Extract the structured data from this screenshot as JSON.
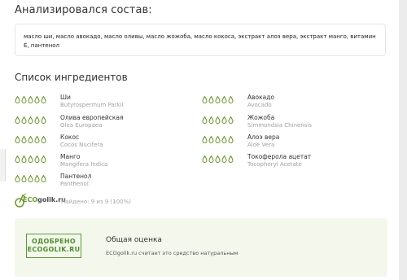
{
  "analyzed": {
    "title": "Анализировался состав:",
    "composition": "масло ши, масло авокадо, масло оливы, масло жожоба, масло кокоса, экстракт алоэ вера, экстракт манго, витамин Е, пантенол"
  },
  "ingredients_section": {
    "title": "Список ингредиентов",
    "drop_count": 5,
    "drop_color": "#6a9a2a",
    "items": [
      {
        "name": "Ши",
        "latin": "Butyrospermum Parkii"
      },
      {
        "name": "Авокадо",
        "latin": "Avocado"
      },
      {
        "name": "Олива европейская",
        "latin": "Olea Europaea"
      },
      {
        "name": "Жожоба",
        "latin": "Simmondsia Chinensis"
      },
      {
        "name": "Кокос",
        "latin": "Cocos Nucifera"
      },
      {
        "name": "Алоэ вера",
        "latin": "Aloe Vera"
      },
      {
        "name": "Манго",
        "latin": "Mangifera Indica"
      },
      {
        "name": "Токоферола ацетат",
        "latin": "Tocopheryl Acetate"
      },
      {
        "name": "Пантенол",
        "latin": "Panthenol"
      }
    ]
  },
  "logo": {
    "eco": "ECO",
    "rest": "golik.ru"
  },
  "found": "Найдено: 9 из 9 (100%)",
  "summary": {
    "stamp_line1": "ОДОБРЕНО",
    "stamp_line2": "ECOGOLIK.RU",
    "title": "Общая оценка",
    "description": "ECOgolik.ru считает это средство натуральным"
  }
}
